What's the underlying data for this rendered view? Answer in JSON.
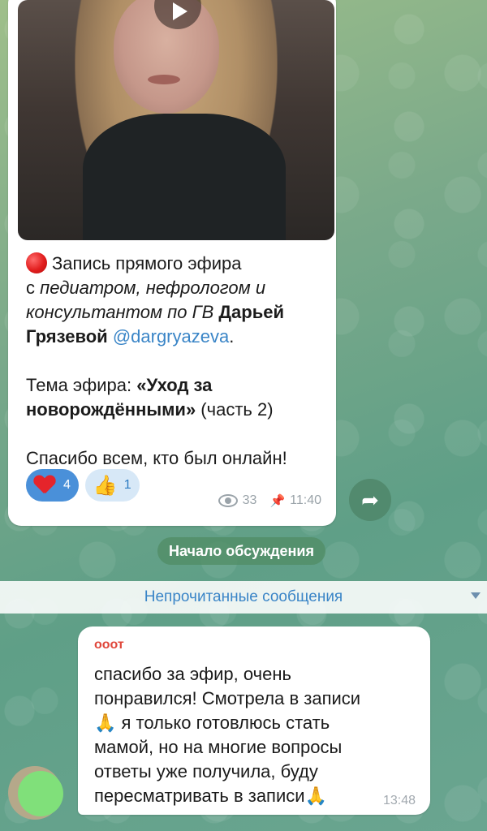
{
  "post": {
    "line1": "Запись прямого эфира",
    "line2_plain": "с ",
    "line2_italic": "педиатром, нефрологом и",
    "line3_italic": "консультантом по ГВ ",
    "line3_bold": "Дарьей",
    "line4_bold": "Грязевой ",
    "mention": "@dargryazeva",
    "line4_end": ".",
    "topic_label": "Тема эфира: ",
    "topic_bold_1": "«Уход за",
    "topic_bold_2": "новорождёнными»",
    "topic_part": " (часть 2)",
    "thanks": "Спасибо всем, кто был онлайн!",
    "reactions": [
      {
        "emoji": "heart",
        "count": "4"
      },
      {
        "emoji": "👍",
        "count": "1"
      }
    ],
    "views": "33",
    "time": "11:40"
  },
  "discussion_start": "Начало обсуждения",
  "unread_label": "Непрочитанные сообщения",
  "comment": {
    "author": "ооот",
    "line1": "спасибо за эфир, очень",
    "line2": "понравился! Смотрела в записи",
    "line3_emoji": "🙏",
    "line3": " я только готовлюсь стать",
    "line4": "мамой, но на многие вопросы",
    "line5": "ответы уже получила, буду",
    "line6": "пересматривать в записи",
    "line6_emoji": "🙏",
    "time": "13:48"
  },
  "colors": {
    "accent": "#3a85c7",
    "reaction_active": "#4a90d9",
    "avatar": "#80e07a"
  }
}
